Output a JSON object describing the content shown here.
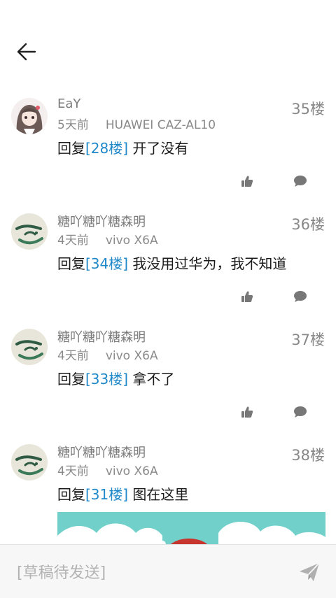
{
  "posts": [
    {
      "username": "EaY",
      "time": "5天前",
      "device": "HUAWEI CAZ-AL10",
      "floor": "35楼",
      "reply_prefix": "回复",
      "reply_ref": "[28楼]",
      "reply_text": "开了没有"
    },
    {
      "username": "糖吖糖吖糖森明",
      "time": "4天前",
      "device": "vivo X6A",
      "floor": "36楼",
      "reply_prefix": "回复",
      "reply_ref": "[34楼]",
      "reply_text": "我没用过华为，我不知道"
    },
    {
      "username": "糖吖糖吖糖森明",
      "time": "4天前",
      "device": "vivo X6A",
      "floor": "37楼",
      "reply_prefix": "回复",
      "reply_ref": "[33楼]",
      "reply_text": "拿不了"
    },
    {
      "username": "糖吖糖吖糖森明",
      "time": "4天前",
      "device": "vivo X6A",
      "floor": "38楼",
      "reply_prefix": "回复",
      "reply_ref": "[31楼]",
      "reply_text": "图在这里"
    }
  ],
  "composer": {
    "placeholder": "[草稿待发送]"
  },
  "icons": {
    "back": "arrow-left-icon",
    "like": "thumbs-up-icon",
    "comment": "comment-bubble-icon",
    "send": "paper-plane-icon"
  },
  "colors": {
    "link": "#1f88c9",
    "meta": "#8a8a8a",
    "icon": "#777777"
  }
}
